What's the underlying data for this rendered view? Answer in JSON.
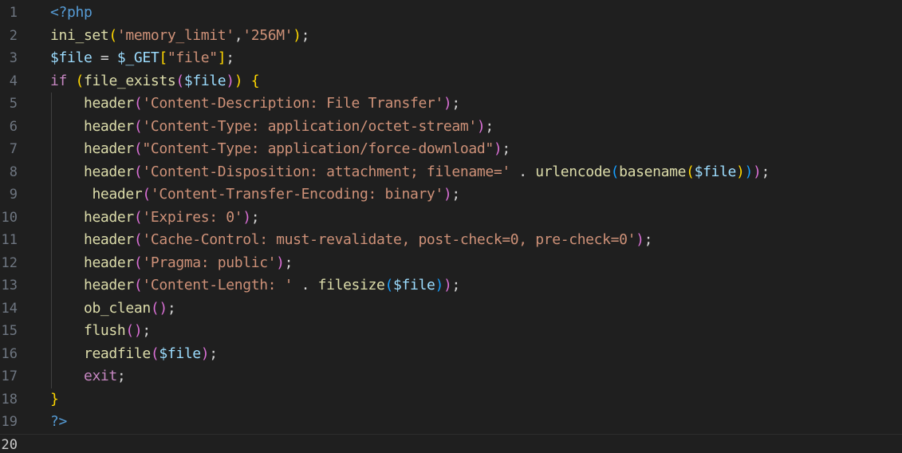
{
  "editor": {
    "language": "php",
    "current_line": 20,
    "colors": {
      "background": "#1f1f1f",
      "line_number": "#6e7681",
      "line_number_current": "#cccccc",
      "php_tag": "#569cd6",
      "function": "#dcdcaa",
      "variable": "#9cdcfe",
      "string": "#ce9178",
      "keyword": "#c586c0",
      "punctuation": "#d4d4d4",
      "bracket_level_1": "#ffd700",
      "bracket_level_2": "#da70d6",
      "bracket_level_3": "#179fff"
    },
    "lines": [
      {
        "number": "1",
        "tokens": [
          {
            "t": "<?php",
            "k": "php"
          }
        ]
      },
      {
        "number": "2",
        "tokens": [
          {
            "t": "ini_set",
            "k": "fn"
          },
          {
            "t": "(",
            "k": "p1"
          },
          {
            "t": "'memory_limit'",
            "k": "str"
          },
          {
            "t": ",",
            "k": "punc"
          },
          {
            "t": "'256M'",
            "k": "str"
          },
          {
            "t": ")",
            "k": "p1"
          },
          {
            "t": ";",
            "k": "punc"
          }
        ]
      },
      {
        "number": "3",
        "tokens": [
          {
            "t": "$file",
            "k": "var"
          },
          {
            "t": " = ",
            "k": "punc"
          },
          {
            "t": "$_GET",
            "k": "var"
          },
          {
            "t": "[",
            "k": "p1"
          },
          {
            "t": "\"file\"",
            "k": "str"
          },
          {
            "t": "]",
            "k": "p1"
          },
          {
            "t": ";",
            "k": "punc"
          }
        ]
      },
      {
        "number": "4",
        "tokens": [
          {
            "t": "if",
            "k": "kw"
          },
          {
            "t": " ",
            "k": "punc"
          },
          {
            "t": "(",
            "k": "p1"
          },
          {
            "t": "file_exists",
            "k": "fn"
          },
          {
            "t": "(",
            "k": "p2"
          },
          {
            "t": "$file",
            "k": "var"
          },
          {
            "t": ")",
            "k": "p2"
          },
          {
            "t": ")",
            "k": "p1"
          },
          {
            "t": " ",
            "k": "punc"
          },
          {
            "t": "{",
            "k": "p1"
          }
        ]
      },
      {
        "number": "5",
        "tokens": [
          {
            "t": "    ",
            "k": "punc"
          },
          {
            "t": "header",
            "k": "fn"
          },
          {
            "t": "(",
            "k": "p2"
          },
          {
            "t": "'Content-Description: File Transfer'",
            "k": "str"
          },
          {
            "t": ")",
            "k": "p2"
          },
          {
            "t": ";",
            "k": "punc"
          }
        ]
      },
      {
        "number": "6",
        "tokens": [
          {
            "t": "    ",
            "k": "punc"
          },
          {
            "t": "header",
            "k": "fn"
          },
          {
            "t": "(",
            "k": "p2"
          },
          {
            "t": "'Content-Type: application/octet-stream'",
            "k": "str"
          },
          {
            "t": ")",
            "k": "p2"
          },
          {
            "t": ";",
            "k": "punc"
          }
        ]
      },
      {
        "number": "7",
        "tokens": [
          {
            "t": "    ",
            "k": "punc"
          },
          {
            "t": "header",
            "k": "fn"
          },
          {
            "t": "(",
            "k": "p2"
          },
          {
            "t": "\"Content-Type: application/force-download\"",
            "k": "str"
          },
          {
            "t": ")",
            "k": "p2"
          },
          {
            "t": ";",
            "k": "punc"
          }
        ]
      },
      {
        "number": "8",
        "tokens": [
          {
            "t": "    ",
            "k": "punc"
          },
          {
            "t": "header",
            "k": "fn"
          },
          {
            "t": "(",
            "k": "p2"
          },
          {
            "t": "'Content-Disposition: attachment; filename='",
            "k": "str"
          },
          {
            "t": " . ",
            "k": "punc"
          },
          {
            "t": "urlencode",
            "k": "fn"
          },
          {
            "t": "(",
            "k": "p3"
          },
          {
            "t": "basename",
            "k": "fn"
          },
          {
            "t": "(",
            "k": "p1"
          },
          {
            "t": "$file",
            "k": "var"
          },
          {
            "t": ")",
            "k": "p1"
          },
          {
            "t": ")",
            "k": "p3"
          },
          {
            "t": ")",
            "k": "p2"
          },
          {
            "t": ";",
            "k": "punc"
          }
        ]
      },
      {
        "number": "9",
        "tokens": [
          {
            "t": "     ",
            "k": "punc"
          },
          {
            "t": "header",
            "k": "fn"
          },
          {
            "t": "(",
            "k": "p2"
          },
          {
            "t": "'Content-Transfer-Encoding: binary'",
            "k": "str"
          },
          {
            "t": ")",
            "k": "p2"
          },
          {
            "t": ";",
            "k": "punc"
          }
        ]
      },
      {
        "number": "10",
        "tokens": [
          {
            "t": "    ",
            "k": "punc"
          },
          {
            "t": "header",
            "k": "fn"
          },
          {
            "t": "(",
            "k": "p2"
          },
          {
            "t": "'Expires: 0'",
            "k": "str"
          },
          {
            "t": ")",
            "k": "p2"
          },
          {
            "t": ";",
            "k": "punc"
          }
        ]
      },
      {
        "number": "11",
        "tokens": [
          {
            "t": "    ",
            "k": "punc"
          },
          {
            "t": "header",
            "k": "fn"
          },
          {
            "t": "(",
            "k": "p2"
          },
          {
            "t": "'Cache-Control: must-revalidate, post-check=0, pre-check=0'",
            "k": "str"
          },
          {
            "t": ")",
            "k": "p2"
          },
          {
            "t": ";",
            "k": "punc"
          }
        ]
      },
      {
        "number": "12",
        "tokens": [
          {
            "t": "    ",
            "k": "punc"
          },
          {
            "t": "header",
            "k": "fn"
          },
          {
            "t": "(",
            "k": "p2"
          },
          {
            "t": "'Pragma: public'",
            "k": "str"
          },
          {
            "t": ")",
            "k": "p2"
          },
          {
            "t": ";",
            "k": "punc"
          }
        ]
      },
      {
        "number": "13",
        "tokens": [
          {
            "t": "    ",
            "k": "punc"
          },
          {
            "t": "header",
            "k": "fn"
          },
          {
            "t": "(",
            "k": "p2"
          },
          {
            "t": "'Content-Length: '",
            "k": "str"
          },
          {
            "t": " . ",
            "k": "punc"
          },
          {
            "t": "filesize",
            "k": "fn"
          },
          {
            "t": "(",
            "k": "p3"
          },
          {
            "t": "$file",
            "k": "var"
          },
          {
            "t": ")",
            "k": "p3"
          },
          {
            "t": ")",
            "k": "p2"
          },
          {
            "t": ";",
            "k": "punc"
          }
        ]
      },
      {
        "number": "14",
        "tokens": [
          {
            "t": "    ",
            "k": "punc"
          },
          {
            "t": "ob_clean",
            "k": "fn"
          },
          {
            "t": "(",
            "k": "p2"
          },
          {
            "t": ")",
            "k": "p2"
          },
          {
            "t": ";",
            "k": "punc"
          }
        ]
      },
      {
        "number": "15",
        "tokens": [
          {
            "t": "    ",
            "k": "punc"
          },
          {
            "t": "flush",
            "k": "fn"
          },
          {
            "t": "(",
            "k": "p2"
          },
          {
            "t": ")",
            "k": "p2"
          },
          {
            "t": ";",
            "k": "punc"
          }
        ]
      },
      {
        "number": "16",
        "tokens": [
          {
            "t": "    ",
            "k": "punc"
          },
          {
            "t": "readfile",
            "k": "fn"
          },
          {
            "t": "(",
            "k": "p2"
          },
          {
            "t": "$file",
            "k": "var"
          },
          {
            "t": ")",
            "k": "p2"
          },
          {
            "t": ";",
            "k": "punc"
          }
        ]
      },
      {
        "number": "17",
        "tokens": [
          {
            "t": "    ",
            "k": "punc"
          },
          {
            "t": "exit",
            "k": "kw"
          },
          {
            "t": ";",
            "k": "punc"
          }
        ]
      },
      {
        "number": "18",
        "tokens": [
          {
            "t": "}",
            "k": "p1"
          }
        ]
      },
      {
        "number": "19",
        "tokens": [
          {
            "t": "?>",
            "k": "php"
          }
        ]
      },
      {
        "number": "20",
        "tokens": []
      }
    ]
  }
}
